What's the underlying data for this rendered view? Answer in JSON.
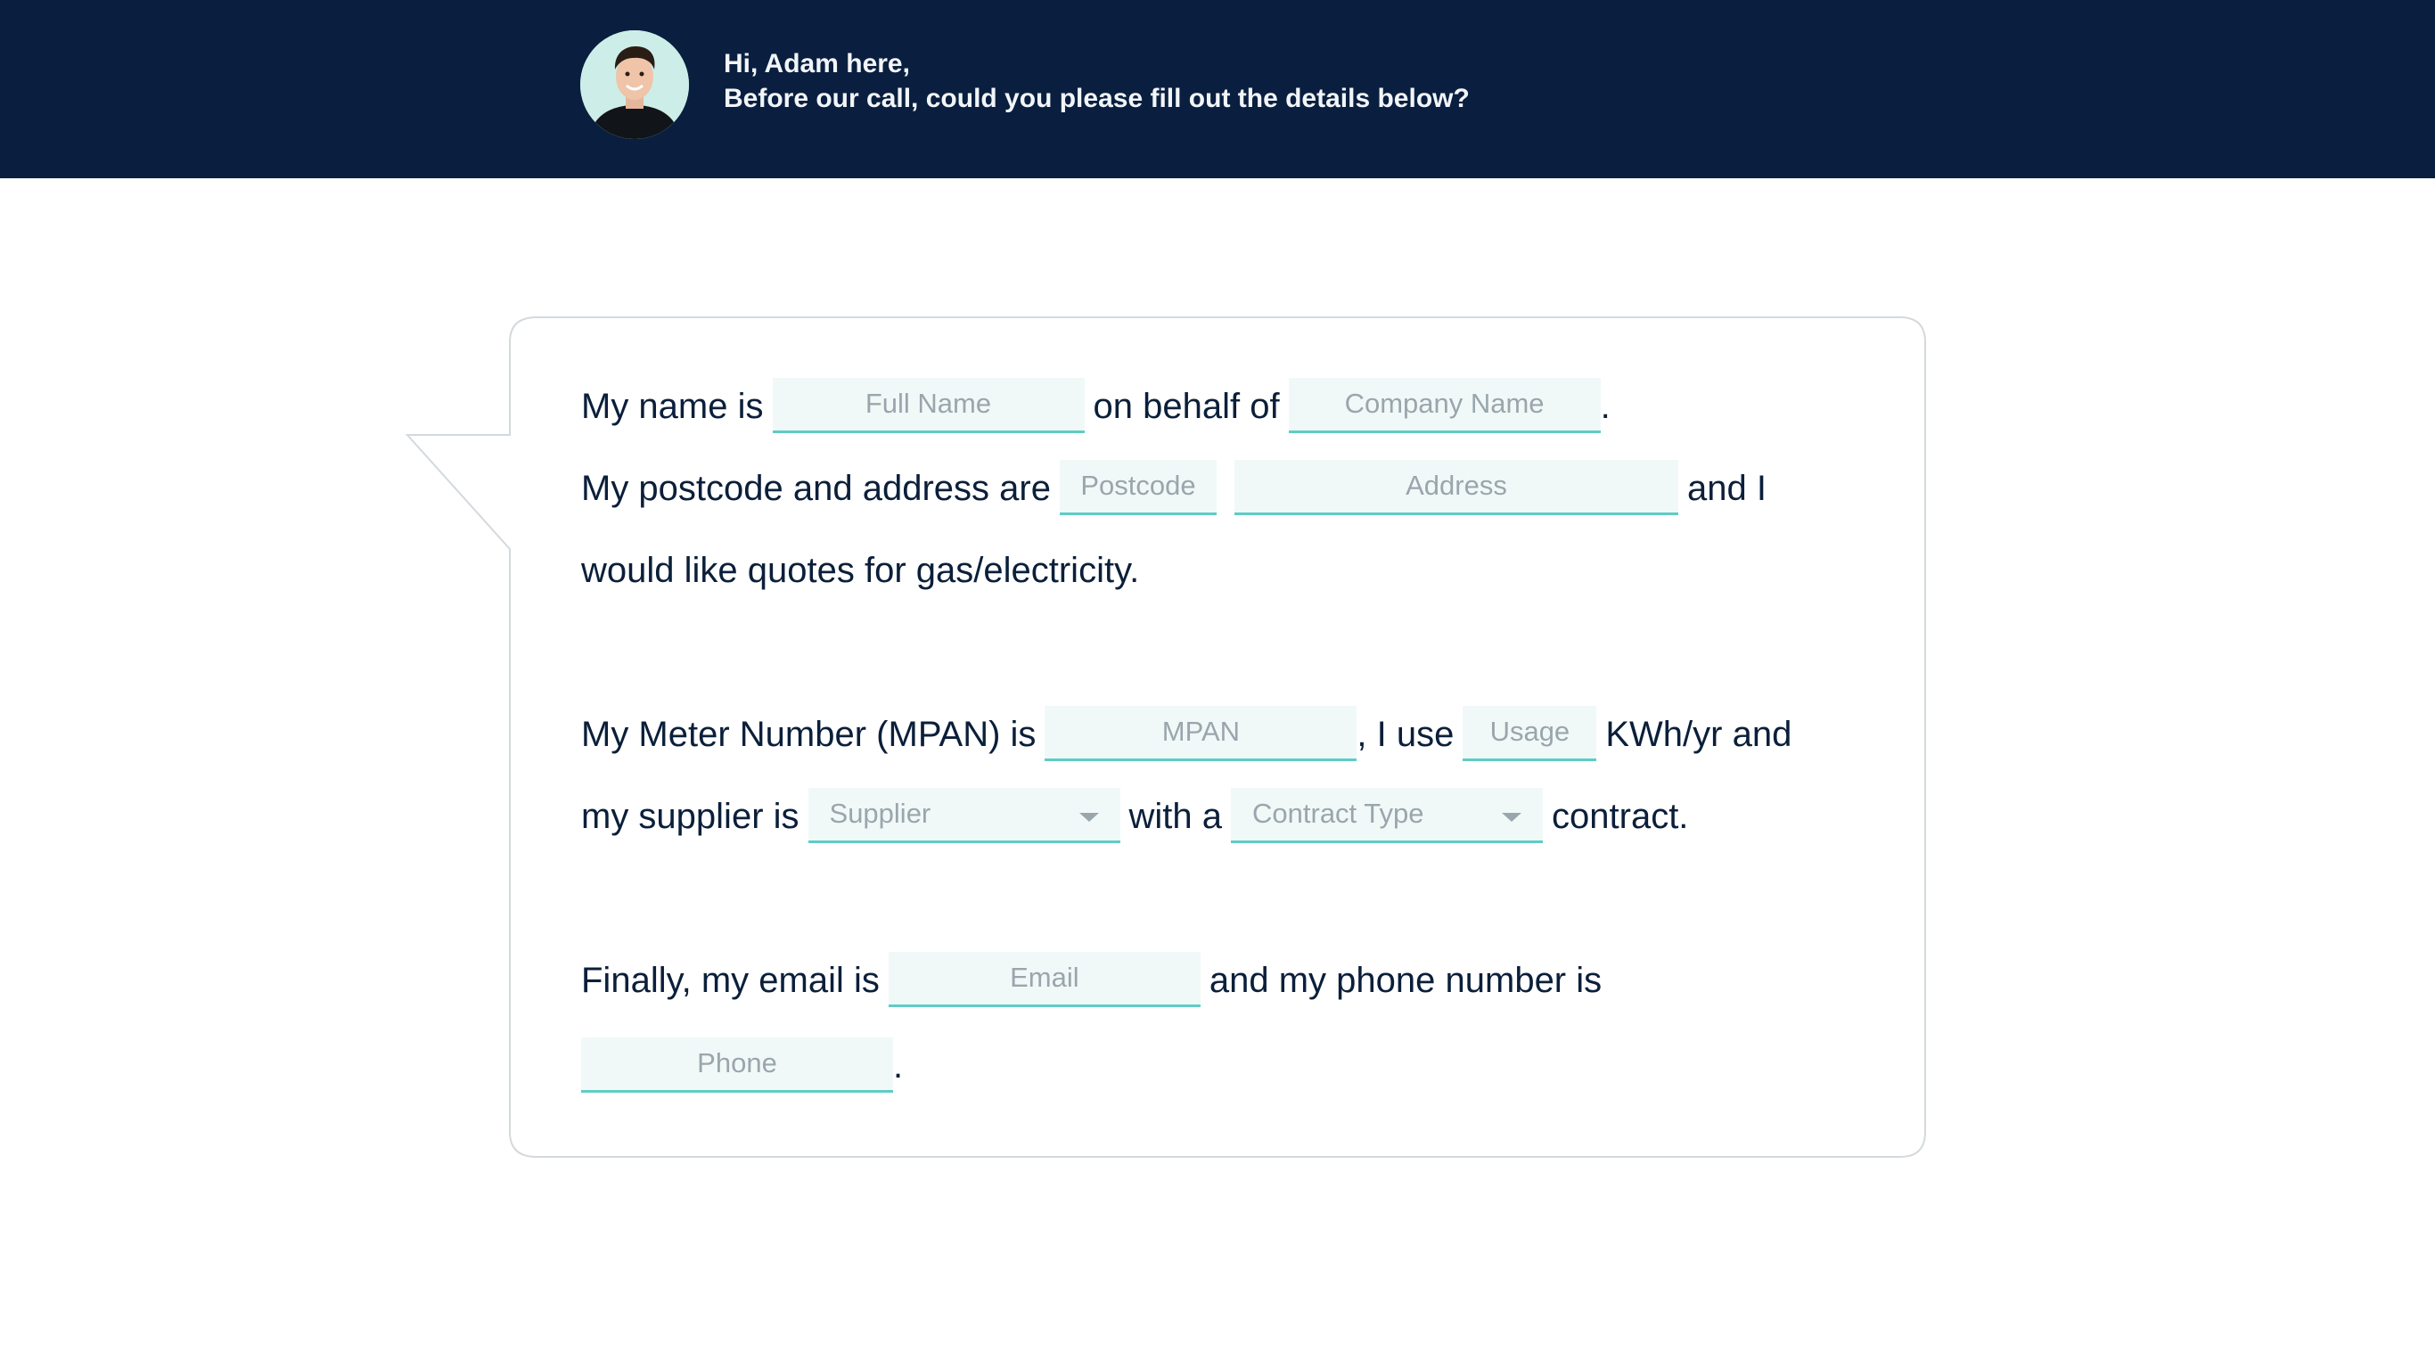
{
  "header": {
    "greeting_line1": "Hi, Adam here,",
    "greeting_line2": "Before our call, could you please fill out the details below?",
    "avatar_alt": "Adam"
  },
  "form": {
    "line1_prefix": "My name is",
    "line1_mid": "on behalf of",
    "line1_end": ".",
    "line2_prefix": "My postcode and address are",
    "line2_end": "and I",
    "line3": "would like quotes for gas/electricity.",
    "line4_prefix": "My Meter Number (MPAN) is",
    "line4_mid": ", I use",
    "line4_end": "KWh/yr and",
    "line5_prefix": "my supplier is",
    "line5_mid": "with a",
    "line5_end": "contract.",
    "line6_prefix": "Finally, my email is",
    "line6_end": "and my phone number is",
    "line7_end": ".",
    "placeholders": {
      "full_name": "Full Name",
      "company_name": "Company Name",
      "postcode": "Postcode",
      "address": "Address",
      "mpan": "MPAN",
      "usage": "Usage",
      "supplier": "Supplier",
      "contract_type": "Contract Type",
      "email": "Email",
      "phone": "Phone"
    }
  },
  "colors": {
    "header_bg": "#0a1f3f",
    "accent": "#5fcdc4",
    "field_bg": "#f1f9f8",
    "text": "#0b1f3a",
    "placeholder": "#9aa6ad"
  }
}
